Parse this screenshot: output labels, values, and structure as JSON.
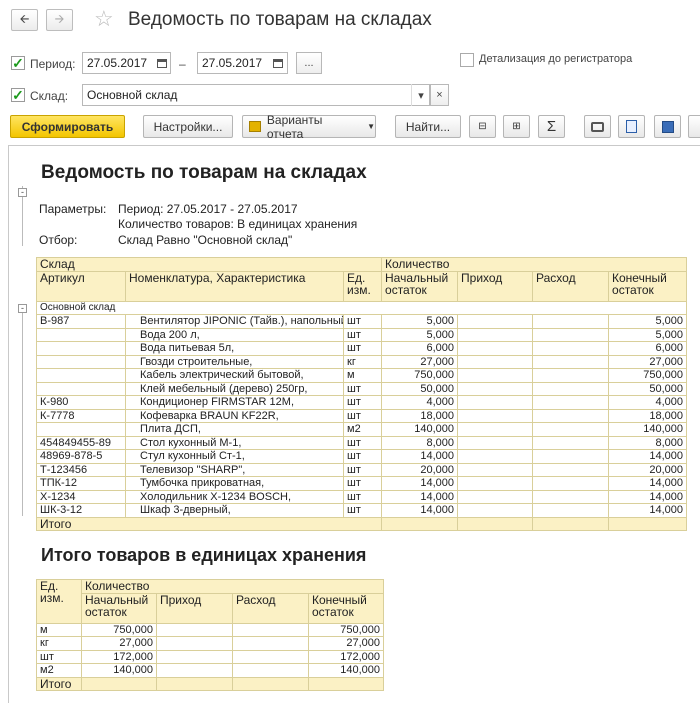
{
  "window": {
    "title": "Ведомость по товарам на складах"
  },
  "filters": {
    "period_label": "Период:",
    "period_from": "27.05.2017",
    "dash": "–",
    "period_to": "27.05.2017",
    "ellipsis": "...",
    "detail_label": "Детализация до регистратора",
    "warehouse_label": "Склад:",
    "warehouse_value": "Основной склад",
    "clear": "×",
    "dropdown": "▾"
  },
  "toolbar": {
    "generate": "Сформировать",
    "settings": "Настройки...",
    "variants": "Варианты отчета",
    "find": "Найти...",
    "sum": "Σ"
  },
  "report": {
    "title": "Ведомость по товарам на складах",
    "params_label": "Параметры:",
    "param1": "Период: 27.05.2017 - 27.05.2017",
    "param2": "Количество товаров: В единицах хранения",
    "filter_label": "Отбор:",
    "filter_value": "Склад Равно \"Основной склад\"",
    "headers": {
      "warehouse": "Склад",
      "quantity": "Количество",
      "article": "Артикул",
      "nomenclature": "Номенклатура, Характеристика",
      "unit": "Ед. изм.",
      "opening": "Начальный остаток",
      "income": "Приход",
      "expense": "Расход",
      "closing": "Конечный остаток"
    },
    "group": "Основной склад",
    "rows": [
      {
        "article": "В-987",
        "name": "Вентилятор JIPONIC (Тайв.), напольный,",
        "unit": "шт",
        "opening": "5,000",
        "closing": "5,000"
      },
      {
        "article": "",
        "name": "Вода 200 л,",
        "unit": "шт",
        "opening": "5,000",
        "closing": "5,000"
      },
      {
        "article": "",
        "name": "Вода питьевая 5л,",
        "unit": "шт",
        "opening": "6,000",
        "closing": "6,000"
      },
      {
        "article": "",
        "name": "Гвозди строительные,",
        "unit": "кг",
        "opening": "27,000",
        "closing": "27,000"
      },
      {
        "article": "",
        "name": "Кабель электрический бытовой,",
        "unit": "м",
        "opening": "750,000",
        "closing": "750,000"
      },
      {
        "article": "",
        "name": "Клей мебельный (дерево) 250гр,",
        "unit": "шт",
        "opening": "50,000",
        "closing": "50,000"
      },
      {
        "article": "К-980",
        "name": "Кондиционер FIRMSTAR 12М,",
        "unit": "шт",
        "opening": "4,000",
        "closing": "4,000"
      },
      {
        "article": "К-7778",
        "name": "Кофеварка BRAUN KF22R,",
        "unit": "шт",
        "opening": "18,000",
        "closing": "18,000"
      },
      {
        "article": "",
        "name": "Плита ДСП,",
        "unit": "м2",
        "opening": "140,000",
        "closing": "140,000"
      },
      {
        "article": "454849455-89",
        "name": "Стол кухонный М-1,",
        "unit": "шт",
        "opening": "8,000",
        "closing": "8,000"
      },
      {
        "article": "48969-878-5",
        "name": "Стул кухонный Ст-1,",
        "unit": "шт",
        "opening": "14,000",
        "closing": "14,000"
      },
      {
        "article": "Т-123456",
        "name": "Телевизор \"SHARP\",",
        "unit": "шт",
        "opening": "20,000",
        "closing": "20,000"
      },
      {
        "article": "ТПК-12",
        "name": "Тумбочка прикроватная,",
        "unit": "шт",
        "opening": "14,000",
        "closing": "14,000"
      },
      {
        "article": "Х-1234",
        "name": "Холодильник Х-1234 BOSCH,",
        "unit": "шт",
        "opening": "14,000",
        "closing": "14,000"
      },
      {
        "article": "ШК-3-12",
        "name": "Шкаф 3-дверный,",
        "unit": "шт",
        "opening": "14,000",
        "closing": "14,000"
      }
    ],
    "total": "Итого",
    "summary_title": "Итого товаров в единицах хранения",
    "summary_rows": [
      {
        "unit": "м",
        "opening": "750,000",
        "closing": "750,000"
      },
      {
        "unit": "кг",
        "opening": "27,000",
        "closing": "27,000"
      },
      {
        "unit": "шт",
        "opening": "172,000",
        "closing": "172,000"
      },
      {
        "unit": "м2",
        "opening": "140,000",
        "closing": "140,000"
      }
    ]
  }
}
